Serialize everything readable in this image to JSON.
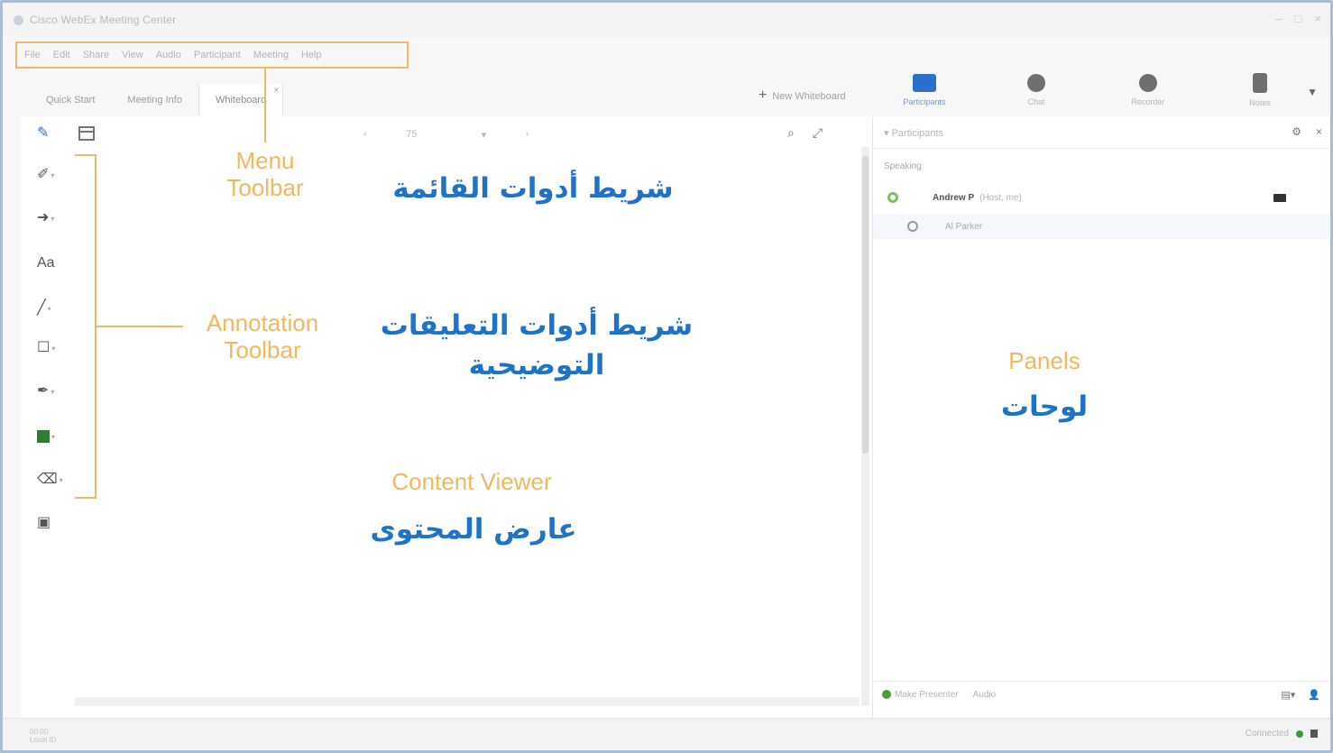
{
  "titlebar": {
    "title": "Cisco WebEx Meeting Center",
    "min": "–",
    "max": "□",
    "close": "×"
  },
  "menu": [
    "File",
    "Edit",
    "Share",
    "View",
    "Audio",
    "Participant",
    "Meeting",
    "Help"
  ],
  "tabs": [
    {
      "label": "Quick Start"
    },
    {
      "label": "Meeting Info"
    },
    {
      "label": "Whiteboard",
      "active": true
    }
  ],
  "new_whiteboard": "New Whiteboard",
  "panel_tabs": [
    {
      "label": "Participants",
      "icon": "participants-icon",
      "active": true
    },
    {
      "label": "Chat",
      "icon": "chat-icon"
    },
    {
      "label": "Recorder",
      "icon": "recorder-icon"
    },
    {
      "label": "Notes",
      "icon": "notes-icon"
    }
  ],
  "zoom": {
    "value": "75"
  },
  "participants_panel": {
    "title": "Participants",
    "section": "Speaking",
    "rows": [
      {
        "name": "Andrew P",
        "role": "(Host, me)"
      },
      {
        "name": "Al Parker"
      }
    ],
    "footer_buttons": [
      "Make Presenter",
      "Audio"
    ]
  },
  "status": {
    "left_line1": "00:00",
    "left_line2": "Local ID",
    "connection": "Connected"
  },
  "callouts": {
    "menu_en": "Menu Toolbar",
    "menu_ar": "شريط أدوات القائمة",
    "annotation_en": "Annotation Toolbar",
    "annotation_ar": "شريط أدوات التعليقات التوضيحية",
    "content_en": "Content Viewer",
    "content_ar": "عارض المحتوى",
    "panels_en": "Panels",
    "panels_ar": "لوحات"
  },
  "colors": {
    "accent_blue": "#2b6fce",
    "callout_orange": "#f2b860",
    "arabic_blue": "#1e73c8",
    "active_color": "#2e7d32"
  }
}
